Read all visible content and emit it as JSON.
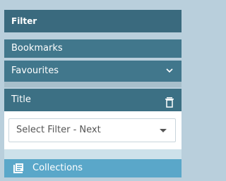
{
  "filter": {
    "header_label": "Filter"
  },
  "items": {
    "bookmarks_label": "Bookmarks",
    "favourites_label": "Favourites"
  },
  "title_section": {
    "label": "Title"
  },
  "select": {
    "value": "Select Filter - Next"
  },
  "collections": {
    "label": "Collections"
  },
  "colors": {
    "header_bg": "#3a6a7e",
    "row_bg": "#41778c",
    "collections_bg": "#5aa7c9",
    "page_bg": "#b9cfdc"
  }
}
